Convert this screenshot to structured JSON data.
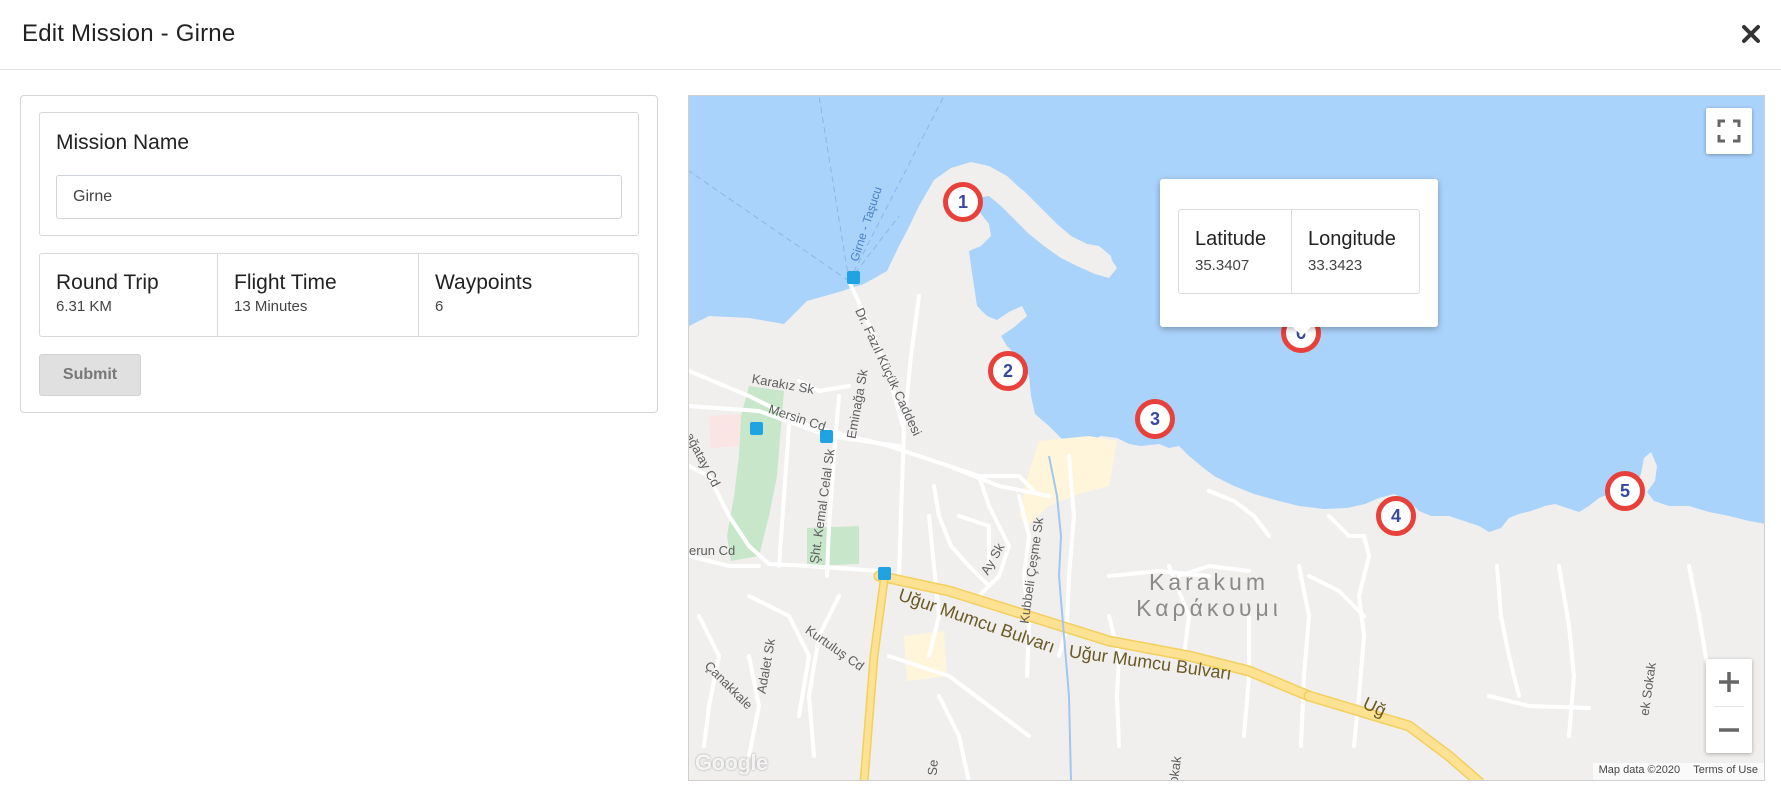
{
  "header": {
    "title": "Edit Mission - Girne",
    "close_icon": "close-icon"
  },
  "form": {
    "mission_name_label": "Mission Name",
    "mission_name_value": "Girne",
    "stats": [
      {
        "label": "Round Trip",
        "value": "6.31 KM"
      },
      {
        "label": "Flight Time",
        "value": "13 Minutes"
      },
      {
        "label": "Waypoints",
        "value": "6"
      }
    ],
    "submit_label": "Submit"
  },
  "map": {
    "waypoints": [
      {
        "label": "1"
      },
      {
        "label": "2"
      },
      {
        "label": "3"
      },
      {
        "label": "4"
      },
      {
        "label": "5"
      },
      {
        "label": "6"
      }
    ],
    "info_window": {
      "latitude_label": "Latitude",
      "latitude_value": "35.3407",
      "longitude_label": "Longitude",
      "longitude_value": "33.3423"
    },
    "place": {
      "line1": "Karakum",
      "line2": "Καράκουμι"
    },
    "streets": {
      "tasucu": "Girne - Taşucu",
      "fazil": "Dr. Fazıl Küçük Caddesi",
      "karakiz": "Karakız Sk",
      "mersin": "Mersin Cd",
      "eminaga": "Eminağa Sk",
      "cagatay": "ağatay Cd",
      "kemal": "Şht. Kemal Celal Sk",
      "erun": "erun Cd",
      "ay": "Ay Sk",
      "kubbeli": "Kubbeli Çeşme Sk",
      "ugur1": "Uğur Mumcu Bulvarı",
      "ugur2": "Uğur Mumcu Bulvarı",
      "ugur3": "Uğ",
      "adalet": "Adalet Sk",
      "kurtulus": "Kurtuluş Cd",
      "canakkale": "Çanakkale",
      "se": "Se",
      "sokak": "ek Sokak",
      "sok2": "okak"
    },
    "google_logo": "Google",
    "attribution": {
      "map_data": "Map data ©2020",
      "terms": "Terms of Use"
    },
    "colors": {
      "water": "#aad3fb",
      "land": "#f1efee",
      "road_major": "#fde293",
      "park": "#c8e6c9",
      "marker_ring": "#e8413b",
      "marker_text": "#3848a0"
    }
  }
}
